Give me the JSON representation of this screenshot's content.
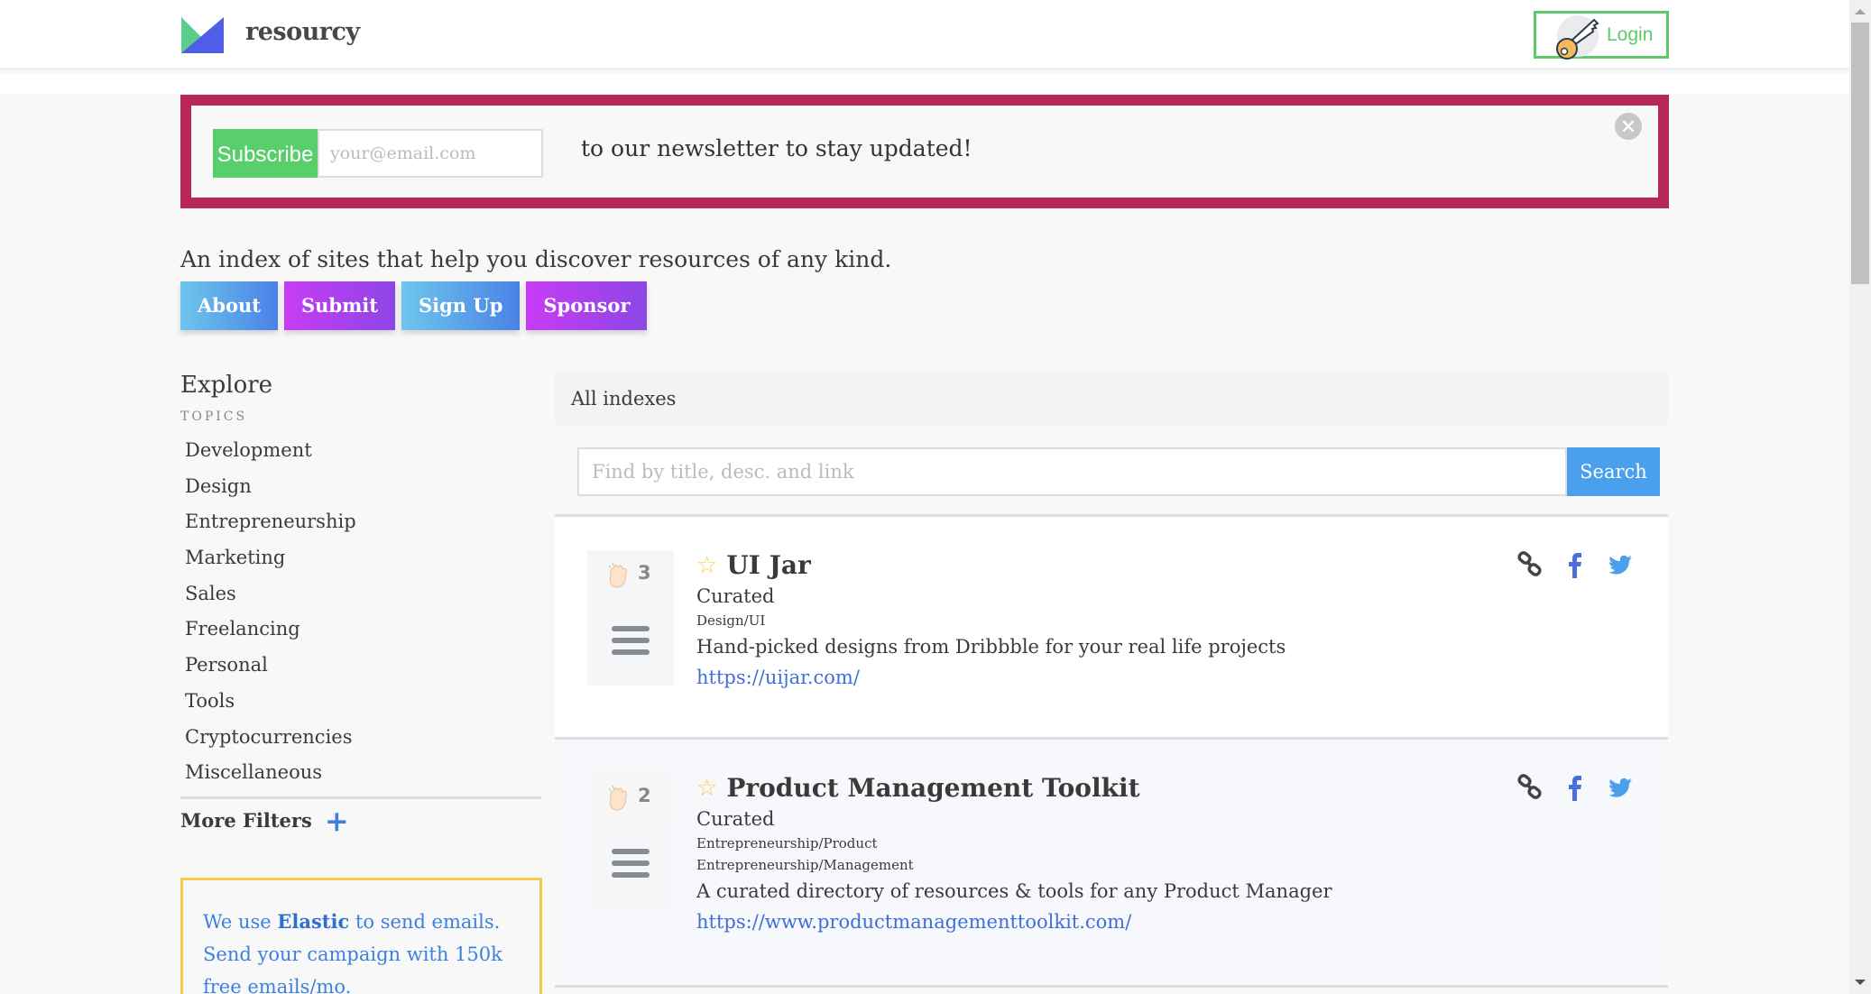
{
  "header": {
    "brand": "resourcy",
    "login_label": "Login",
    "colors": {
      "logo_green": "#5ccc8a",
      "logo_blue": "#4f5ee8",
      "login_green": "#5bcb6a"
    }
  },
  "banner": {
    "subscribe_label": "Subscribe",
    "email_placeholder": "your@email.com",
    "email_value": "",
    "text": "to our newsletter to stay updated!",
    "close_icon": "close-icon",
    "border_color": "#b8275a"
  },
  "tagline": "An index of sites that help you discover resources of any kind.",
  "nav_buttons": [
    {
      "label": "About",
      "style": "blue"
    },
    {
      "label": "Submit",
      "style": "purple"
    },
    {
      "label": "Sign Up",
      "style": "blue"
    },
    {
      "label": "Sponsor",
      "style": "purple"
    }
  ],
  "sidebar": {
    "title": "Explore",
    "section_label": "TOPICS",
    "topics": [
      "Development",
      "Design",
      "Entrepreneurship",
      "Marketing",
      "Sales",
      "Freelancing",
      "Personal",
      "Tools",
      "Cryptocurrencies",
      "Miscellaneous"
    ],
    "more_filters_label": "More Filters",
    "sponsor": {
      "prefix": "We use ",
      "brand": "Elastic",
      "suffix": " to send emails. Send your campaign with 150k free emails/mo."
    }
  },
  "main": {
    "heading": "All indexes",
    "search_placeholder": "Find by title, desc. and link",
    "search_value": "",
    "search_button": "Search",
    "cards": [
      {
        "votes": "3",
        "title": "UI Jar",
        "type": "Curated",
        "categories": [
          "Design/UI"
        ],
        "description": "Hand-picked designs from Dribbble for your real life projects",
        "url": "https://uijar.com/"
      },
      {
        "votes": "2",
        "title": "Product Management Toolkit",
        "type": "Curated",
        "categories": [
          "Entrepreneurship/Product",
          "Entrepreneurship/Management"
        ],
        "description": "A curated directory of resources & tools for any Product Manager",
        "url": "https://www.productmanagementtoolkit.com/"
      }
    ]
  }
}
